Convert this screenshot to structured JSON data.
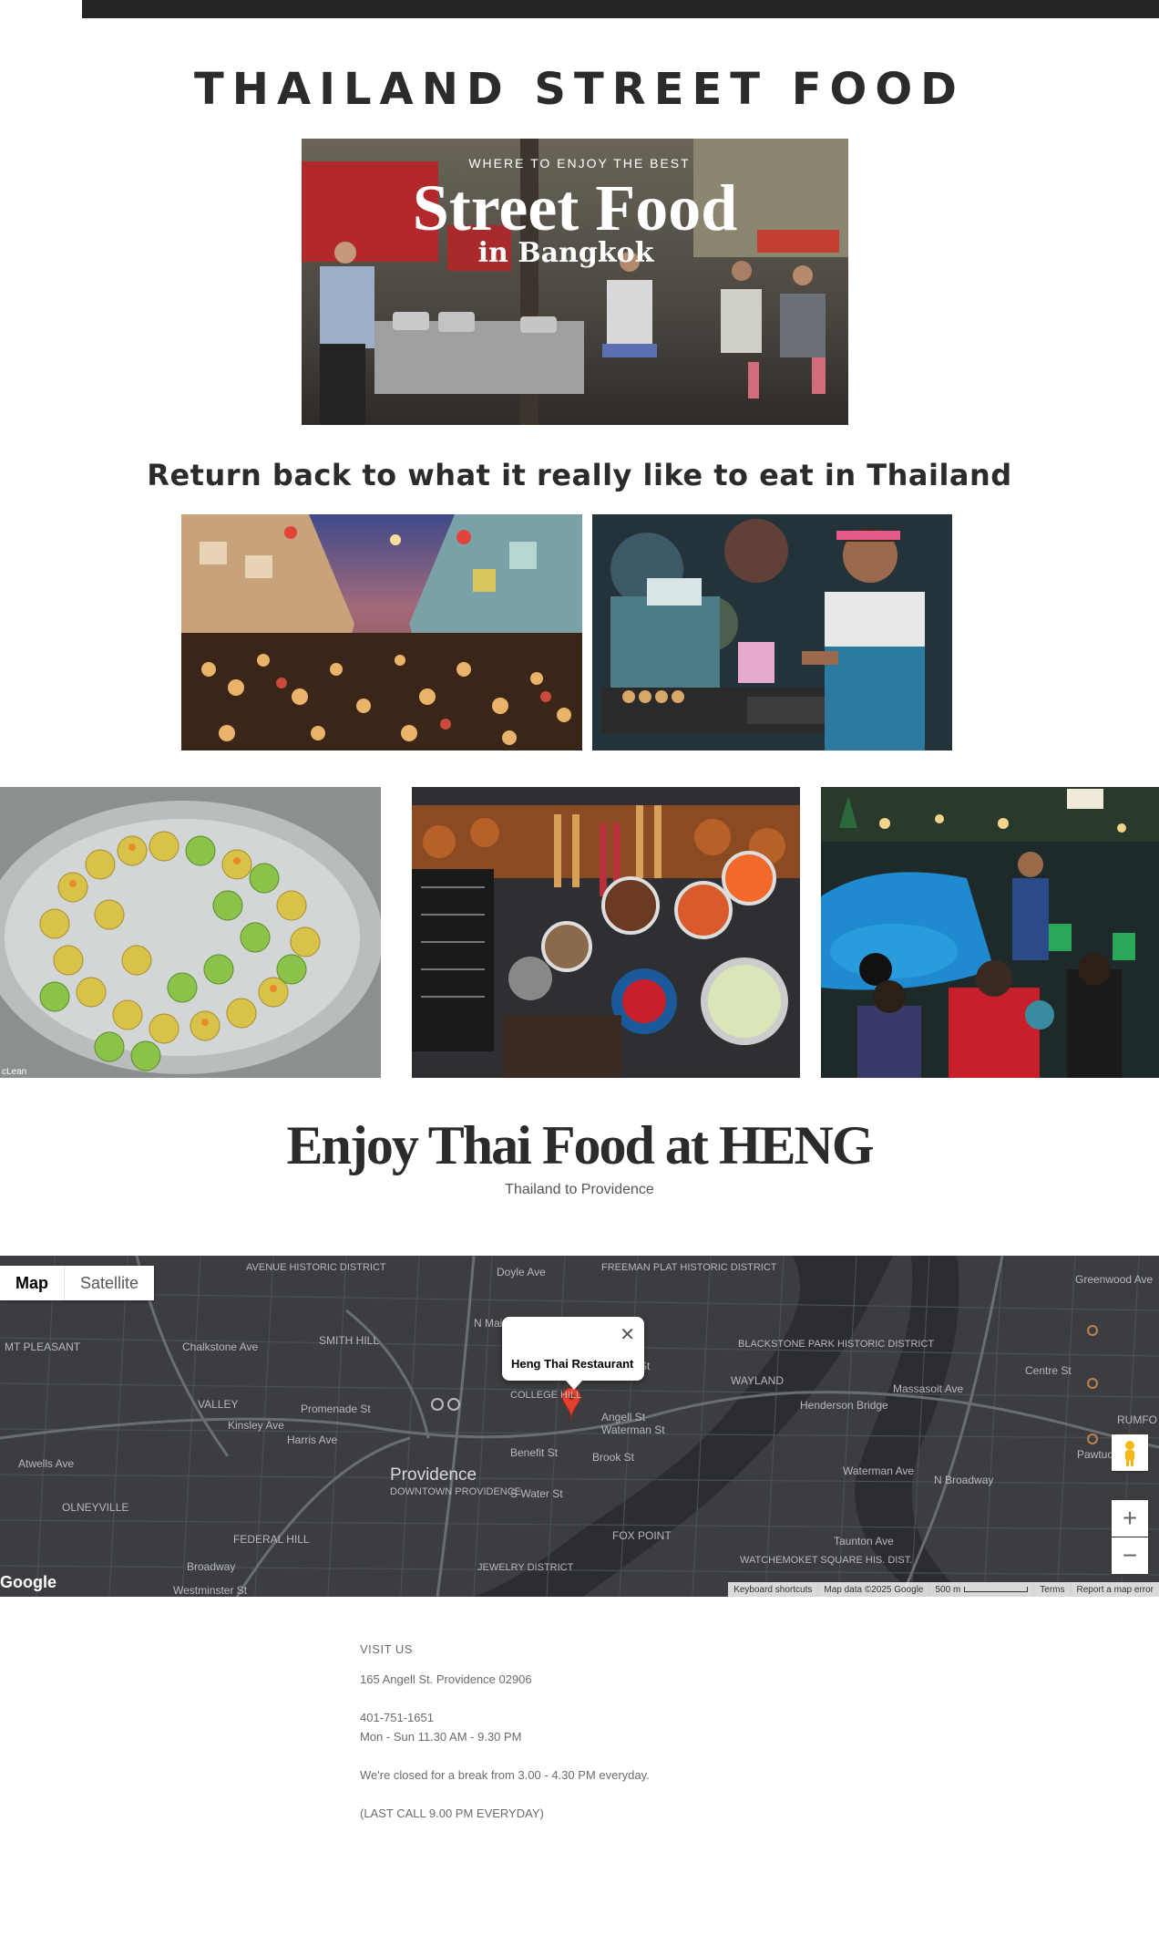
{
  "header": {
    "title": "THAILAND STREET FOOD"
  },
  "hero": {
    "kicker": "WHERE TO ENJOY THE BEST",
    "title": "Street Food",
    "sub": "in Bangkok"
  },
  "tagline": "Return back to what it really like to eat in Thailand",
  "gallery": {
    "dumplings_credit": "cLean"
  },
  "restaurant": {
    "title": "Enjoy Thai Food at HENG",
    "subtitle": "Thailand to Providence"
  },
  "map": {
    "type_map": "Map",
    "type_satellite": "Satellite",
    "popup_name": "Heng Thai Restaurant",
    "logo": "Google",
    "footer": {
      "shortcuts": "Keyboard shortcuts",
      "data": "Map data ©2025 Google",
      "scale": "500 m",
      "terms": "Terms",
      "report": "Report a map error"
    },
    "labels": [
      "AVENUE HISTORIC DISTRICT",
      "Doyle Ave",
      "FREEMAN PLAT HISTORIC DISTRICT",
      "MT PLEASANT",
      "Chalkstone Ave",
      "SMITH HILL",
      "BLACKSTONE PARK HISTORIC DISTRICT",
      "WAYLAND",
      "COLLEGE HILL",
      "Henderson Bridge",
      "VALLEY",
      "Promenade St",
      "Angell St",
      "Waterman St",
      "Atwells Ave",
      "Providence",
      "DOWNTOWN PROVIDENCE",
      "OLNEYVILLE",
      "FEDERAL HILL",
      "FOX POINT",
      "Taunton Ave",
      "WATCHEMOKET SQUARE HIS. DIST.",
      "JEWELRY DISTRICT",
      "Broadway",
      "Westminster St",
      "Harris Ave",
      "Kinsley Ave",
      "N Main St",
      "S Water St",
      "Benefit St",
      "Brook St",
      "Hope St",
      "Massasoit Ave",
      "Waterman Ave",
      "N Broadway",
      "Pawtucket Ave",
      "RUMFO",
      "Greenwood Ave",
      "Centre St"
    ]
  },
  "visit": {
    "heading": "VISIT US",
    "address": "165 Angell St. Providence 02906",
    "phone": "401-751-1651",
    "hours": "Mon - Sun  11.30 AM - 9.30 PM",
    "break_note": "We're closed for a break from 3.00 - 4.30 PM everyday.",
    "last_call": "(LAST CALL 9.00 PM EVERYDAY)"
  },
  "colors": {
    "map_bg": "#3b3d40",
    "pin": "#e3422f",
    "title": "#2b2b2b"
  }
}
